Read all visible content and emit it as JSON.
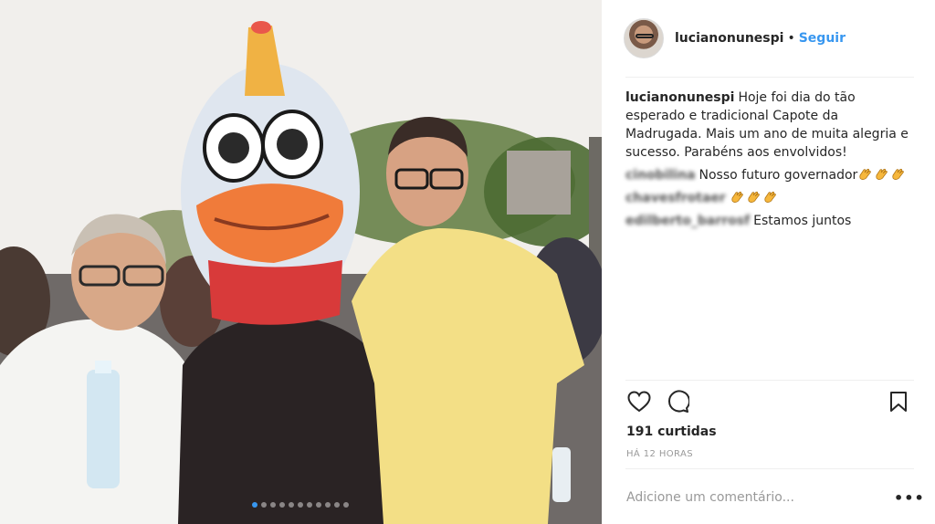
{
  "post": {
    "author": "lucianonunespi",
    "separator": "•",
    "follow_label": "Seguir",
    "caption": "Hoje foi dia do tão esperado e tradicional Capote da Madrugada. Mais um ano de muita alegria e sucesso. Parabéns aos envolvidos!"
  },
  "comments": [
    {
      "user": "cinobilina",
      "text": "Nosso futuro governador",
      "emoji": [
        "clap",
        "clap",
        "clap"
      ]
    },
    {
      "user": "chavesfrotaer",
      "text": "",
      "emoji": [
        "clap",
        "clap",
        "clap"
      ]
    },
    {
      "user": "edilberto_barrosf",
      "text": "Estamos juntos",
      "emoji": []
    }
  ],
  "stats": {
    "likes": "191 curtidas",
    "time": "HÁ 12 HORAS"
  },
  "add_comment": {
    "placeholder": "Adicione um comentário...",
    "more": "•••"
  },
  "carousel": {
    "count": 11,
    "active_index": 0
  },
  "icons": {
    "like": "heart-icon",
    "comment": "comment-icon",
    "save": "bookmark-icon",
    "clap": "clapping-hands-emoji"
  },
  "colors": {
    "link": "#3897f0",
    "text": "#262626",
    "muted": "#999999",
    "divider": "#efefef"
  }
}
